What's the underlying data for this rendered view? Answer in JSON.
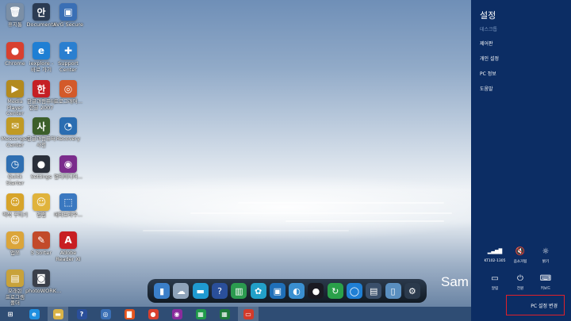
{
  "desktop": {
    "brand_text": "Sam",
    "icons": [
      {
        "label": "휴지통",
        "name": "recycle-bin-icon",
        "glyph": "🗑",
        "color": "#7b8fa6"
      },
      {
        "label": "Documents",
        "name": "documents-shortcut-icon",
        "glyph": "안",
        "color": "#2b3b52"
      },
      {
        "label": "AVG Secure",
        "name": "avg-secure-icon",
        "glyph": "▣",
        "color": "#3a6fb5"
      },
      {
        "label": "Chrome",
        "name": "chrome-icon",
        "glyph": "●",
        "color": "#d8402f"
      },
      {
        "label": "iexplore -\n바로 가기",
        "name": "internet-explorer-icon",
        "glyph": "e",
        "color": "#1f7fd4"
      },
      {
        "label": "Support\nCenter",
        "name": "support-center-icon",
        "glyph": "✚",
        "color": "#2a7fd0"
      },
      {
        "label": "Media Player\nCenter",
        "name": "media-player-center-icon",
        "glyph": "▶",
        "color": "#b38a1e"
      },
      {
        "label": "한글과컴퓨터\n한글 2007",
        "name": "hangul-2007-icon",
        "glyph": "한",
        "color": "#c51f24"
      },
      {
        "label": "프로그래머...",
        "name": "programmer-tool-icon",
        "glyph": "◎",
        "color": "#d35a2a"
      },
      {
        "label": "Messenger\nCenter",
        "name": "messenger-center-icon",
        "glyph": "✉",
        "color": "#c09a24"
      },
      {
        "label": "한글과컴퓨터\n사전",
        "name": "hangul-dictionary-icon",
        "glyph": "사",
        "color": "#3c5f2a"
      },
      {
        "label": "Recovery",
        "name": "recovery-icon",
        "glyph": "◔",
        "color": "#2a6db1"
      },
      {
        "label": "Quick Starter",
        "name": "quick-starter-icon",
        "glyph": "◷",
        "color": "#2f6fb2"
      },
      {
        "label": "Settings",
        "name": "settings-icon",
        "glyph": "●",
        "color": "#2a2f3a"
      },
      {
        "label": "멀티미디어...",
        "name": "multimedia-icon",
        "glyph": "◉",
        "color": "#7b2c8c"
      },
      {
        "label": "맥북 꾸미기",
        "name": "decorate-icon",
        "glyph": "☺",
        "color": "#d7a42a"
      },
      {
        "label": "앱랩",
        "name": "app-lab-icon",
        "glyph": "☺",
        "color": "#e0b33c"
      },
      {
        "label": "메타브라우...",
        "name": "meta-browser-icon",
        "glyph": "⬚",
        "color": "#3a78c0"
      },
      {
        "label": "앱쪼",
        "name": "app-helper-icon",
        "glyph": "☺",
        "color": "#dba53a"
      },
      {
        "label": "S Sorter",
        "name": "s-sorter-icon",
        "glyph": "✎",
        "color": "#c24a2a"
      },
      {
        "label": "Adobe\nReader XI",
        "name": "adobe-reader-icon",
        "glyph": "A",
        "color": "#c81e22"
      },
      {
        "label": "오래된\n프로그램\n폴더",
        "name": "old-programs-folder-icon",
        "glyph": "▤",
        "color": "#c8a23a"
      },
      {
        "label": "photoWORK...",
        "name": "photowork-icon",
        "glyph": "◙",
        "color": "#3a3f4a"
      }
    ]
  },
  "dock": {
    "items": [
      {
        "name": "dock-app-1-icon",
        "glyph": "▮",
        "color": "#3b7fc9"
      },
      {
        "name": "dock-app-2-icon",
        "glyph": "☁",
        "color": "#8fa3ba"
      },
      {
        "name": "dock-app-3-icon",
        "glyph": "▬",
        "color": "#1f9ad1"
      },
      {
        "name": "dock-help-icon",
        "glyph": "?",
        "color": "#2a4f9a"
      },
      {
        "name": "dock-app-5-icon",
        "glyph": "▥",
        "color": "#2b9a4f"
      },
      {
        "name": "dock-app-6-icon",
        "glyph": "✿",
        "color": "#22a0c8"
      },
      {
        "name": "dock-app-7-icon",
        "glyph": "▣",
        "color": "#1f6fb8"
      },
      {
        "name": "dock-app-8-icon",
        "glyph": "◐",
        "color": "#3a8fd0"
      },
      {
        "name": "dock-app-9-icon",
        "glyph": "●",
        "color": "#1a1a22"
      },
      {
        "name": "dock-app-10-icon",
        "glyph": "↻",
        "color": "#2aa04a"
      },
      {
        "name": "dock-app-11-icon",
        "glyph": "◯",
        "color": "#1f7fd4"
      },
      {
        "name": "dock-app-12-icon",
        "glyph": "▤",
        "color": "#3a4f6a"
      },
      {
        "name": "dock-app-13-icon",
        "glyph": "▯",
        "color": "#5a8fc0"
      },
      {
        "name": "dock-gear-icon",
        "glyph": "⚙",
        "color": "#2b3a4c"
      }
    ]
  },
  "taskbar": {
    "items": [
      {
        "name": "start-button",
        "glyph": "⊞",
        "color": "#2f4d74",
        "active": false
      },
      {
        "name": "taskbar-ie-icon",
        "glyph": "e",
        "color": "#1f8fe0",
        "active": false
      },
      {
        "name": "taskbar-explorer-icon",
        "glyph": "▬",
        "color": "#d9b347",
        "active": true
      },
      {
        "name": "taskbar-help-icon",
        "glyph": "?",
        "color": "#2a4f9a",
        "active": false
      },
      {
        "name": "taskbar-app-icon",
        "glyph": "◎",
        "color": "#3a6fb5",
        "active": false
      },
      {
        "name": "taskbar-office-icon",
        "glyph": "▇",
        "color": "#e4541f",
        "active": false
      },
      {
        "name": "taskbar-chrome-icon",
        "glyph": "●",
        "color": "#d8402f",
        "active": false
      },
      {
        "name": "taskbar-media-icon",
        "glyph": "◉",
        "color": "#8a2c9c",
        "active": false
      },
      {
        "name": "taskbar-store-icon",
        "glyph": "▦",
        "color": "#1f9a4a",
        "active": false
      },
      {
        "name": "taskbar-excel-icon",
        "glyph": "▦",
        "color": "#1e7a3a",
        "active": false
      },
      {
        "name": "taskbar-paint-icon",
        "glyph": "▭",
        "color": "#d23a2a",
        "active": true
      }
    ]
  },
  "charm": {
    "title": "설정",
    "subtitle": "데스크톱",
    "links": [
      "제어판",
      "개인 설정",
      "PC 정보",
      "도움말"
    ],
    "quick_settings": [
      {
        "label": "KT102-1305",
        "icon": "▂▄▆█",
        "name": "network-icon"
      },
      {
        "label": "음소거됨",
        "icon": "🔇",
        "name": "volume-muted-icon"
      },
      {
        "label": "밝기",
        "icon": "☼",
        "name": "brightness-icon"
      },
      {
        "label": "알림",
        "icon": "▭",
        "name": "notifications-icon"
      },
      {
        "label": "전원",
        "icon": "⏻",
        "name": "power-icon"
      },
      {
        "label": "키보드",
        "icon": "⌨",
        "name": "keyboard-icon"
      }
    ],
    "pc_settings_label": "PC 설정 변경"
  }
}
